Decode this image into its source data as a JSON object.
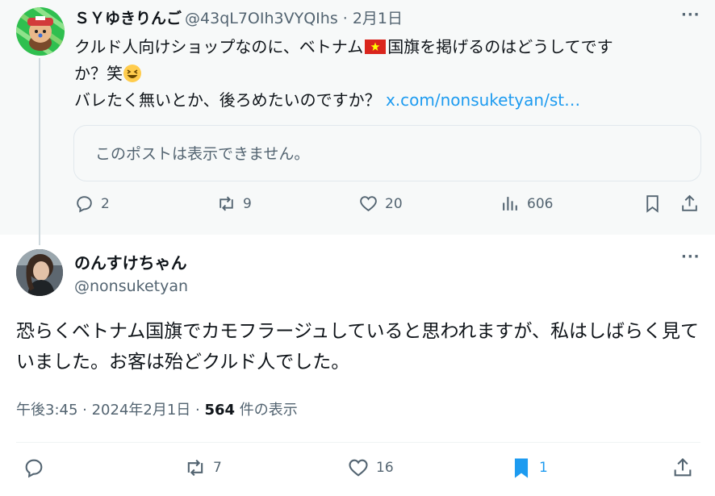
{
  "parent_post": {
    "display_name": "ＳＹゆきりんご",
    "meta": "@43qL7OIh3VYQIhs · 2月1日",
    "text_line1_a": "クルド人向けショップなのに、ベトナム",
    "text_line1_b": "国旗を掲げるのはどうしてです",
    "text_line2": "か？笑",
    "text_line3": "バレたく無いとか、後ろめたいのですか？ ",
    "link": "x.com/nonsuketyan/st…",
    "quote_notice": "このポストは表示できません。",
    "replies": "2",
    "reposts": "9",
    "likes": "20",
    "views": "606"
  },
  "reply_post": {
    "display_name": "のんすけちゃん",
    "handle": "@nonsuketyan",
    "text": "恐らくベトナム国旗でカモフラージュしていると思われますが、私はしばらく見ていました。お客は殆どクルド人でした。",
    "time": "午後3:45 · 2024年2月1日 · ",
    "view_count": "564",
    "view_label": " 件の表示",
    "reposts": "7",
    "likes": "16",
    "bookmarks": "1"
  },
  "colors": {
    "accent": "#1d9bf0",
    "muted": "#536471",
    "flag_red": "#da251d",
    "flag_star": "#ffff00"
  },
  "icons": [
    "reply-icon",
    "repost-icon",
    "like-icon",
    "views-icon",
    "bookmark-icon",
    "share-icon",
    "more-icon"
  ]
}
